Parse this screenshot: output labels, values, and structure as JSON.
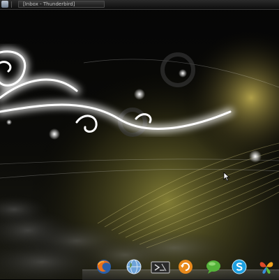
{
  "taskbar": {
    "window_button": {
      "title": "[Inbox - Thunderbird]",
      "icon": "thunderbird-icon"
    },
    "app_menu_icon": "app-menu-icon"
  },
  "dock": {
    "items": [
      {
        "name": "firefox",
        "icon": "firefox-icon"
      },
      {
        "name": "network",
        "icon": "globe-icon"
      },
      {
        "name": "terminal",
        "icon": "terminal-icon"
      },
      {
        "name": "update-manager",
        "icon": "refresh-icon"
      },
      {
        "name": "chat",
        "icon": "chat-bubble-icon"
      },
      {
        "name": "skype",
        "icon": "skype-icon"
      },
      {
        "name": "messenger",
        "icon": "butterfly-icon"
      }
    ]
  },
  "colors": {
    "desktop_background": "#000000",
    "wallpaper_glow": "#ffffff",
    "wallpaper_gold": "#c9b84a"
  }
}
